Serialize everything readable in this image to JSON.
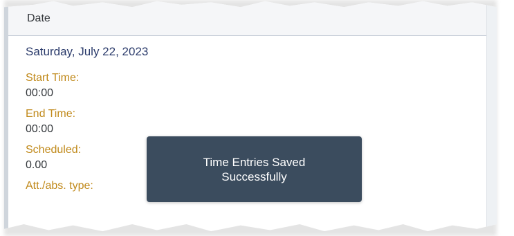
{
  "header": {
    "label": "Date"
  },
  "date_value": "Saturday, July 22, 2023",
  "fields": [
    {
      "label": "Start Time:",
      "value": "00:00"
    },
    {
      "label": "End Time:",
      "value": "00:00"
    },
    {
      "label": "Scheduled:",
      "value": "0.00"
    },
    {
      "label": "Att./abs. type:",
      "value": ""
    }
  ],
  "toast": {
    "line1": "Time Entries Saved",
    "line2": "Successfully"
  },
  "colors": {
    "label": "#c0891a",
    "date_value": "#2b3b6b",
    "toast_bg": "#3b4c5e"
  }
}
